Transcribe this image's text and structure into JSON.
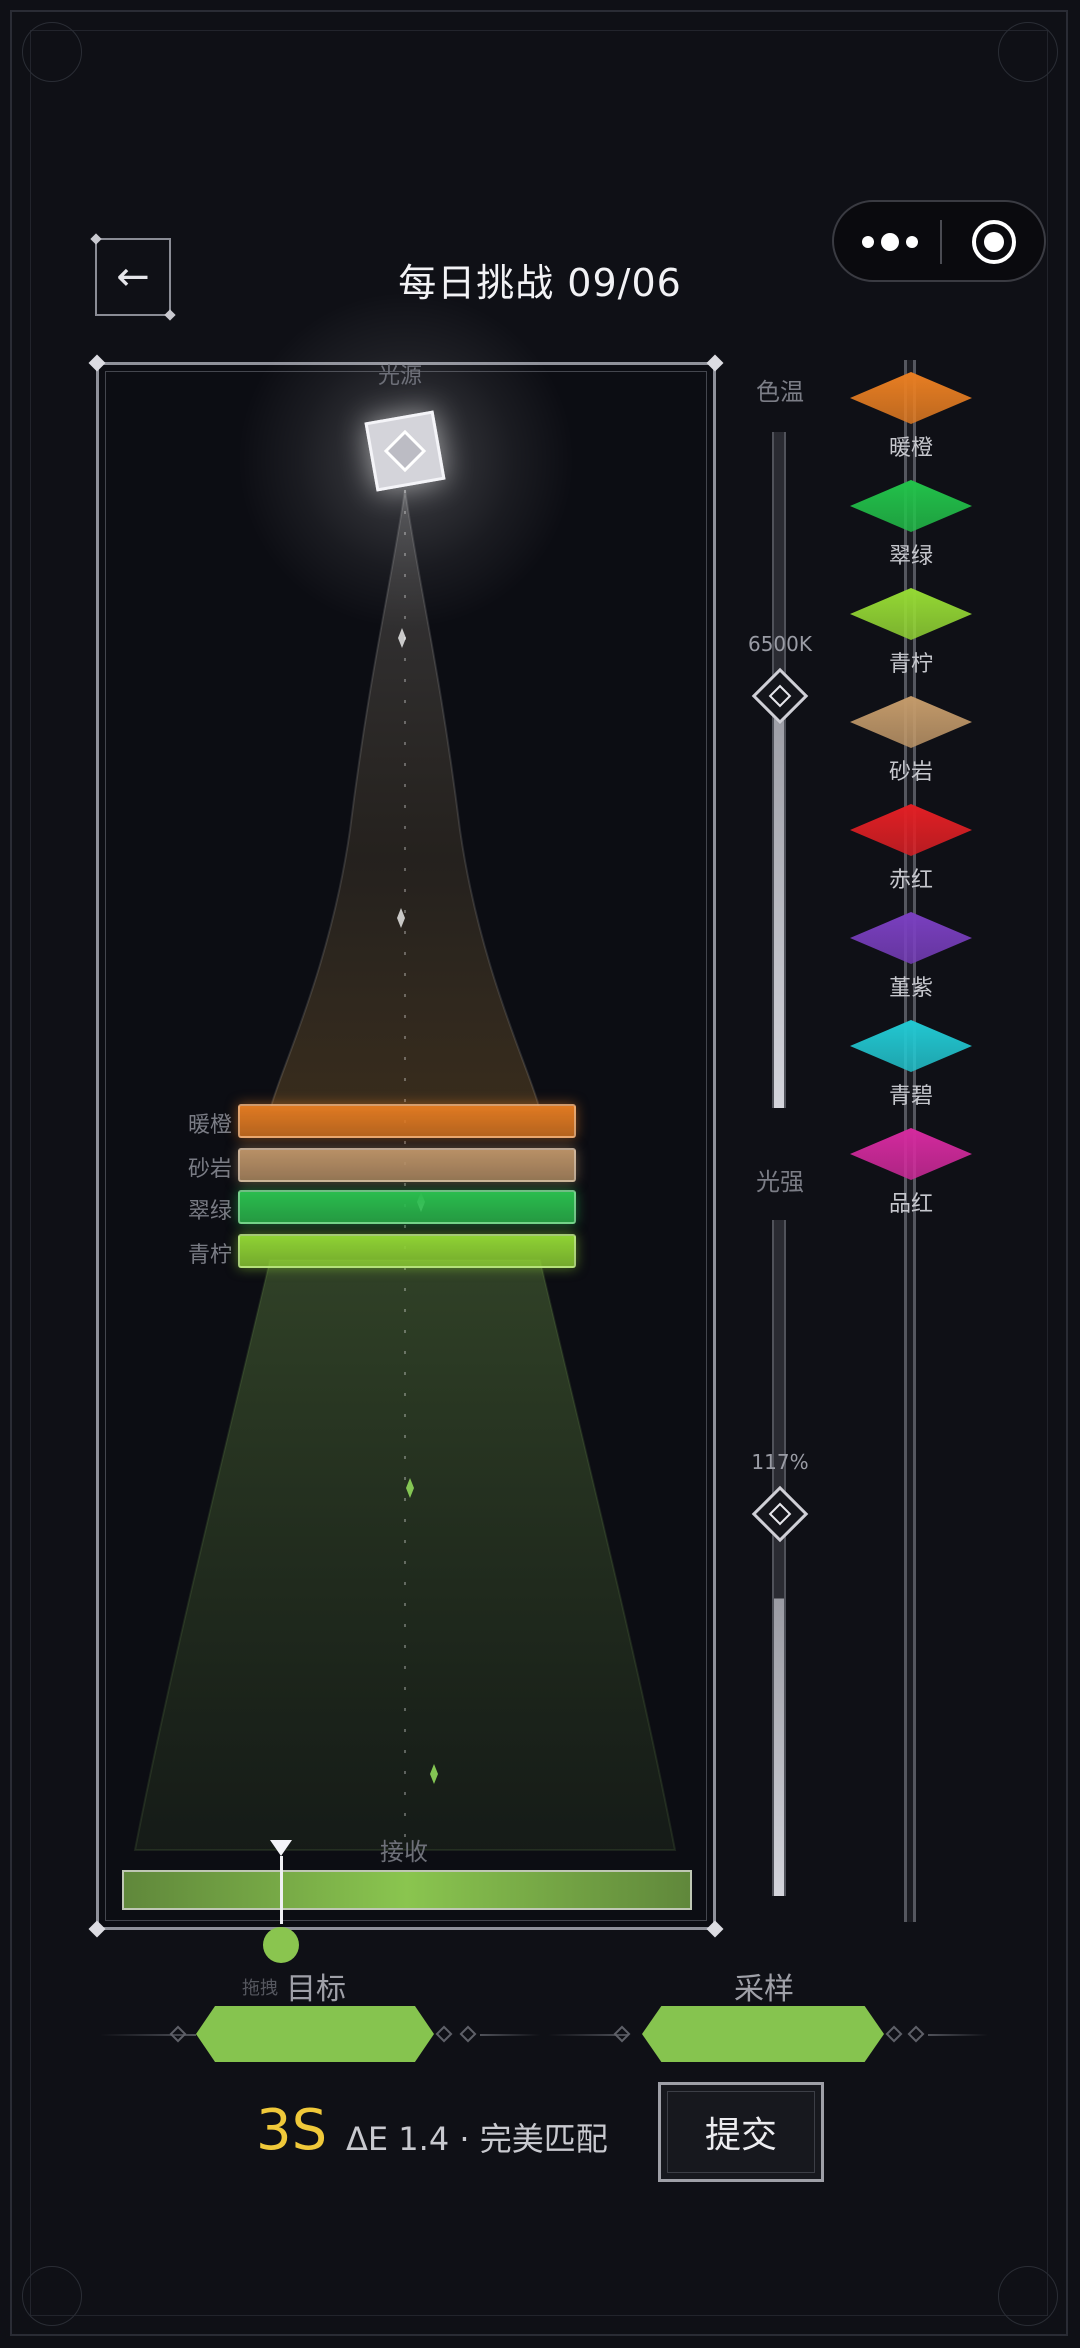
{
  "header": {
    "back_icon": "←",
    "title": "每日挑战 09/06",
    "menu_more_icon": "more-dots-icon",
    "menu_close_icon": "target-close-icon"
  },
  "playfield": {
    "source_label": "光源",
    "receiver_label": "接收",
    "drag_hint": "拖拽",
    "filters": [
      {
        "label": "暖橙",
        "color": "#e07a22"
      },
      {
        "label": "砂岩",
        "color": "#b89066"
      },
      {
        "label": "翠绿",
        "color": "#2bbd4e"
      },
      {
        "label": "青柠",
        "color": "#8fd234"
      }
    ],
    "receiver_color": "#8ac54f",
    "receiver_marker_fraction": 0.18
  },
  "sliders": {
    "color_temp": {
      "label": "色温",
      "value": "6500K",
      "fraction": 0.62
    },
    "intensity": {
      "label": "光强",
      "value": "117%",
      "fraction": 0.44
    }
  },
  "palette": [
    {
      "label": "暖橙",
      "color": "#e87e22"
    },
    {
      "label": "翠绿",
      "color": "#22c24a"
    },
    {
      "label": "青柠",
      "color": "#95d934"
    },
    {
      "label": "砂岩",
      "color": "#c39a6a"
    },
    {
      "label": "赤红",
      "color": "#e11f24"
    },
    {
      "label": "堇紫",
      "color": "#7a3fc0"
    },
    {
      "label": "青碧",
      "color": "#22c8d2"
    },
    {
      "label": "品红",
      "color": "#d42a9e"
    }
  ],
  "compare": {
    "target_label": "目标",
    "sample_label": "采样",
    "target_color": "#86c44f",
    "sample_color": "#86c44f"
  },
  "result": {
    "timer": "3S",
    "summary": "ΔE 1.4 · 完美匹配",
    "submit_label": "提交"
  }
}
